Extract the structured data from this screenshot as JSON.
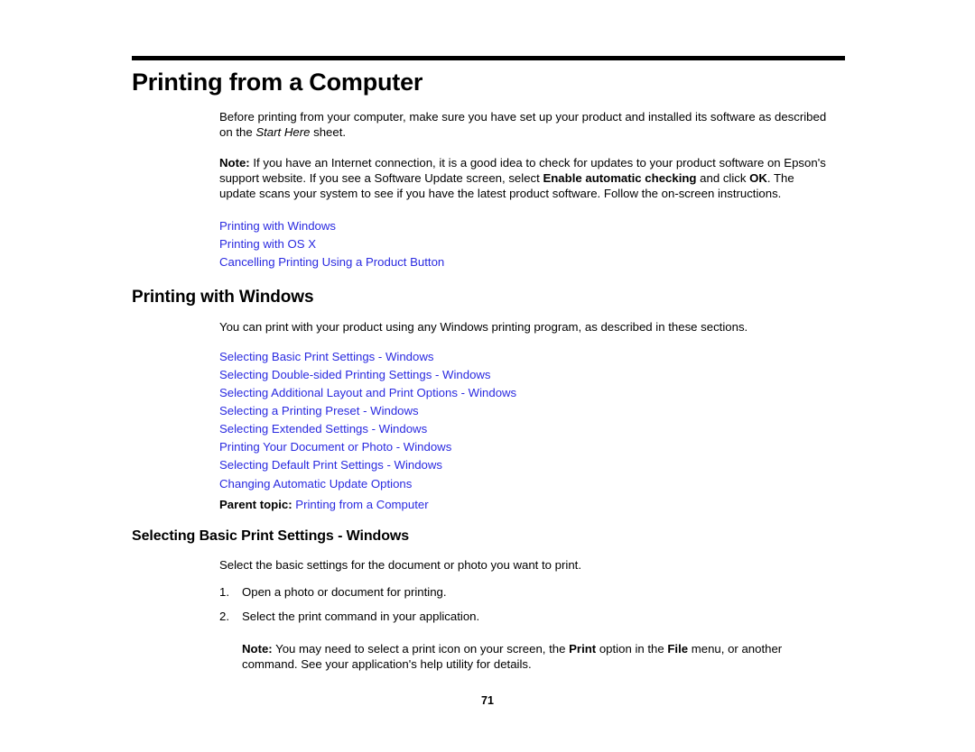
{
  "document": {
    "title": "Printing from a Computer",
    "page_number": "71"
  },
  "intro": {
    "paragraph_start": "Before printing from your computer, make sure you have set up your product and installed its software as described on the ",
    "paragraph_italic": "Start Here",
    "paragraph_end": " sheet."
  },
  "note_update": {
    "label": "Note:",
    "text_1": " If you have an Internet connection, it is a good idea to check for updates to your product software on Epson's support website. If you see a Software Update screen, select ",
    "bold_1": "Enable automatic checking",
    "text_2": " and click ",
    "bold_2": "OK",
    "text_3": ". The update scans your system to see if you have the latest product software. Follow the on-screen instructions."
  },
  "top_links": [
    {
      "label": "Printing with Windows"
    },
    {
      "label": "Printing with OS X"
    },
    {
      "label": "Cancelling Printing Using a Product Button"
    }
  ],
  "windows_section": {
    "heading": "Printing with Windows",
    "intro": "You can print with your product using any Windows printing program, as described in these sections.",
    "links": [
      {
        "label": "Selecting Basic Print Settings - Windows"
      },
      {
        "label": "Selecting Double-sided Printing Settings - Windows"
      },
      {
        "label": "Selecting Additional Layout and Print Options - Windows"
      },
      {
        "label": "Selecting a Printing Preset - Windows"
      },
      {
        "label": "Selecting Extended Settings - Windows"
      },
      {
        "label": "Printing Your Document or Photo - Windows"
      },
      {
        "label": "Selecting Default Print Settings - Windows"
      },
      {
        "label": "Changing Automatic Update Options"
      }
    ],
    "parent_topic_label": "Parent topic:",
    "parent_topic_link": "Printing from a Computer"
  },
  "basic_settings_section": {
    "heading": "Selecting Basic Print Settings - Windows",
    "intro": "Select the basic settings for the document or photo you want to print.",
    "steps": [
      {
        "num": "1.",
        "text": "Open a photo or document for printing."
      },
      {
        "num": "2.",
        "text": "Select the print command in your application."
      }
    ],
    "note": {
      "label": "Note:",
      "text_1": " You may need to select a print icon on your screen, the ",
      "bold_1": "Print",
      "text_2": " option in the ",
      "bold_2": "File",
      "text_3": " menu, or another command. See your application's help utility for details."
    }
  },
  "colors": {
    "link": "#2a2ae0",
    "text": "#000000",
    "background": "#ffffff"
  }
}
